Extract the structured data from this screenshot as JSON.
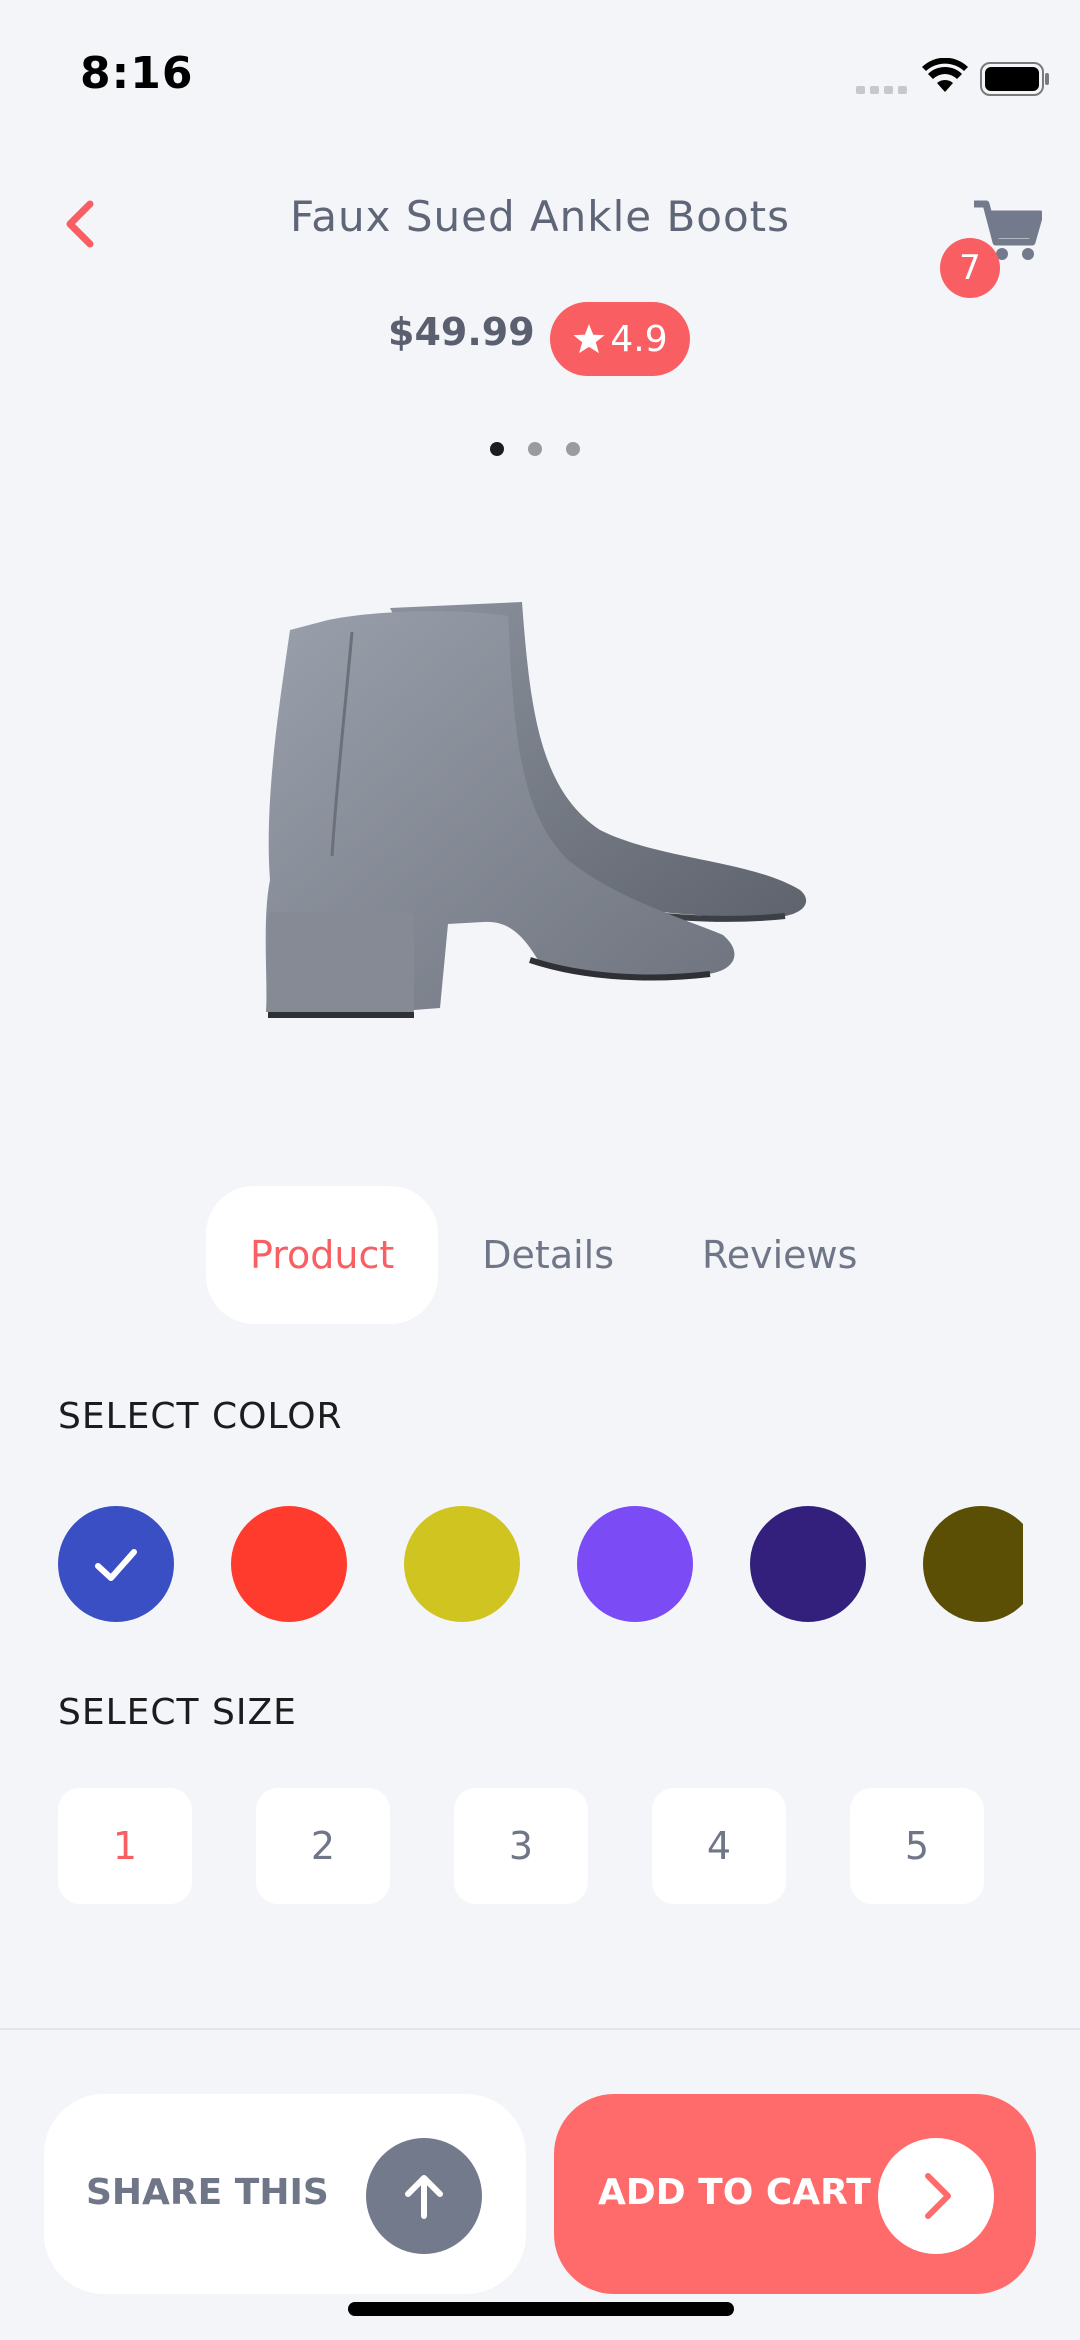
{
  "status_bar": {
    "time": "8:16"
  },
  "header": {
    "title": "Faux Sued Ankle Boots",
    "cart_count": "7",
    "price": "$49.99",
    "rating": "4.9"
  },
  "carousel": {
    "total_slides": 3,
    "active_index": 0
  },
  "tabs": [
    {
      "label": "Product",
      "active": true
    },
    {
      "label": "Details",
      "active": false
    },
    {
      "label": "Reviews",
      "active": false
    }
  ],
  "color_section": {
    "label": "SELECT COLOR",
    "swatches": [
      "#3a4fc4",
      "#ff3b2e",
      "#cfc420",
      "#7b4bf6",
      "#33207c",
      "#5b4f05"
    ],
    "selected_index": 0
  },
  "size_section": {
    "label": "SELECT SIZE",
    "sizes": [
      "1",
      "2",
      "3",
      "4",
      "5"
    ],
    "selected_index": 0
  },
  "actions": {
    "share_label": "SHARE THIS",
    "add_to_cart_label": "ADD TO CART"
  },
  "colors": {
    "accent": "#f95f62",
    "background": "#f4f5f8",
    "muted_text": "#6f7687"
  }
}
